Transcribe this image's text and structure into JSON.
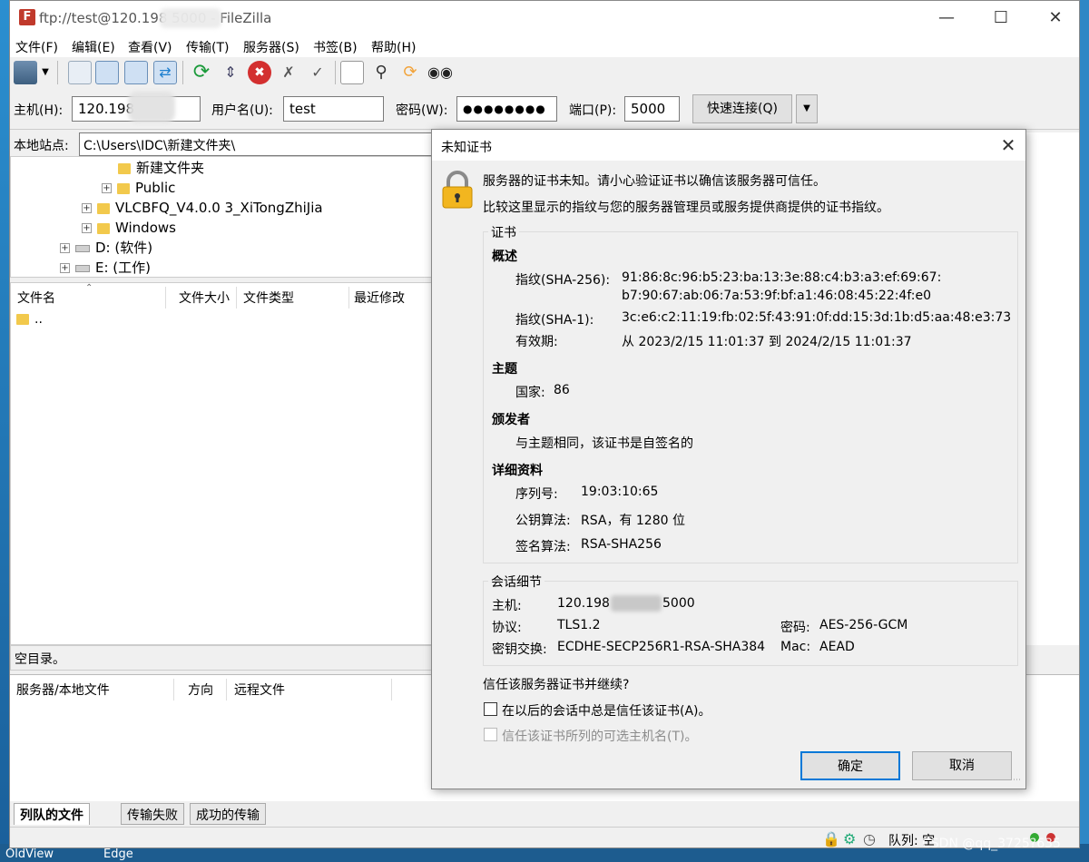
{
  "window": {
    "title": "ftp://test@120.198            5000 - FileZilla",
    "app_icon_letter": "F"
  },
  "menu": [
    "文件(F)",
    "编辑(E)",
    "查看(V)",
    "传输(T)",
    "服务器(S)",
    "书签(B)",
    "帮助(H)"
  ],
  "toolbar": {
    "icons": [
      "site-manager-icon",
      "toggle-message-log-icon",
      "toggle-local-tree-icon",
      "toggle-remote-tree-icon",
      "toggle-queue-icon",
      "refresh-icon",
      "process-queue-icon",
      "cancel-icon",
      "disconnect-icon",
      "reconnect-icon",
      "directory-filter-icon",
      "search-icon",
      "sync-browse-icon",
      "find-files-icon"
    ]
  },
  "quickconnect": {
    "host_label": "主机(H):",
    "host_value": "120.198",
    "user_label": "用户名(U):",
    "user_value": "test",
    "password_label": "密码(W):",
    "password_value": "●●●●●●●●",
    "port_label": "端口(P):",
    "port_value": "5000",
    "connect_button": "快速连接(Q)"
  },
  "local": {
    "site_label": "本地站点:",
    "path": "C:\\Users\\IDC\\新建文件夹\\",
    "tree": [
      {
        "label": "新建文件夹",
        "type": "folder",
        "expander": ""
      },
      {
        "label": "Public",
        "type": "folder",
        "expander": "+"
      },
      {
        "label": "VLCBFQ_V4.0.0 3_XiTongZhiJia",
        "type": "folder",
        "expander": "+"
      },
      {
        "label": "Windows",
        "type": "folder",
        "expander": "+"
      },
      {
        "label": "D: (软件)",
        "type": "drive",
        "expander": "+"
      },
      {
        "label": "E: (工作)",
        "type": "drive",
        "expander": "+"
      }
    ],
    "columns": [
      "文件名",
      "文件大小",
      "文件类型",
      "最近修改"
    ],
    "files": [
      ".."
    ],
    "status": "空目录。"
  },
  "queue": {
    "columns": [
      "服务器/本地文件",
      "方向",
      "远程文件"
    ],
    "tabs": [
      "列队的文件",
      "传输失败",
      "成功的传输"
    ]
  },
  "statusbar": {
    "queue_label": "队列: 空"
  },
  "dialog": {
    "title": "未知证书",
    "line1": "服务器的证书未知。请小心验证证书以确信该服务器可信任。",
    "line2": "比较这里显示的指纹与您的服务器管理员或服务提供商提供的证书指纹。",
    "cert_group": "证书",
    "overview": "概述",
    "sha256_label": "指纹(SHA-256):",
    "sha256_line1": "91:86:8c:96:b5:23:ba:13:3e:88:c4:b3:a3:ef:69:67:",
    "sha256_line2": "b7:90:67:ab:06:7a:53:9f:bf:a1:46:08:45:22:4f:e0",
    "sha1_label": "指纹(SHA-1):",
    "sha1_value": "3c:e6:c2:11:19:fb:02:5f:43:91:0f:dd:15:3d:1b:d5:aa:48:e3:73",
    "validity_label": "有效期:",
    "validity_value": "从 2023/2/15 11:01:37 到 2024/2/15 11:01:37",
    "subject": "主题",
    "country_label": "国家:",
    "country_value": "86",
    "issuer": "颁发者",
    "issuer_value": "与主题相同，该证书是自签名的",
    "details": "详细资料",
    "serial_label": "序列号:",
    "serial_value": "19:03:10:65",
    "pubkey_label": "公钥算法:",
    "pubkey_value": "RSA，有 1280 位",
    "sig_label": "签名算法:",
    "sig_value": "RSA-SHA256",
    "session_group": "会话细节",
    "host_label": "主机:",
    "host_value_a": "120.198",
    "host_value_b": "5000",
    "protocol_label": "协议:",
    "protocol_value": "TLS1.2",
    "cipher_label": "密码:",
    "cipher_value": "AES-256-GCM",
    "kex_label": "密钥交换:",
    "kex_value": "ECDHE-SECP256R1-RSA-SHA384",
    "mac_label": "Mac:",
    "mac_value": "AEAD",
    "trust_question": "信任该服务器证书并继续?",
    "always_trust": "在以后的会话中总是信任该证书(A)。",
    "trust_alt": "信任该证书所列的可选主机名(T)。",
    "ok": "确定",
    "cancel": "取消"
  },
  "desktop": {
    "bottom_labels": [
      "OldView",
      "Edge"
    ],
    "watermark": "CSDN @qq_3725?635"
  }
}
